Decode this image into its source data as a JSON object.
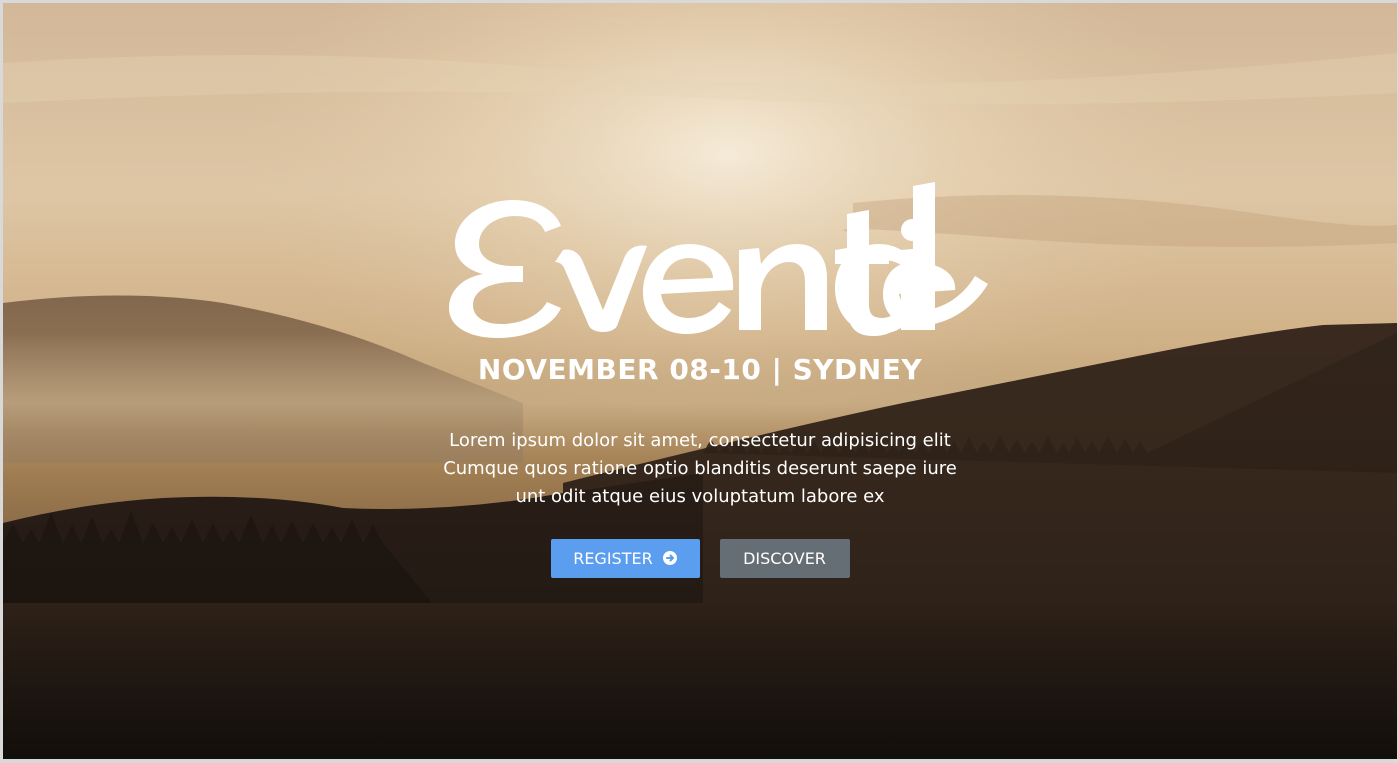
{
  "brand": {
    "logo_text": "Eventide"
  },
  "hero": {
    "date_location": "NOVEMBER 08-10 | SYDNEY",
    "description_lines": [
      "Lorem ipsum dolor sit amet, consectetur adipisicing elit",
      "Cumque quos ratione optio blanditis deserunt saepe iure",
      "unt odit atque eius voluptatum labore ex"
    ]
  },
  "buttons": {
    "register_label": "REGISTER",
    "register_icon": "arrow-circle-right-icon",
    "discover_label": "DISCOVER"
  },
  "colors": {
    "register_bg": "#5b9ef0",
    "discover_bg": "#656d75",
    "text": "#ffffff"
  }
}
